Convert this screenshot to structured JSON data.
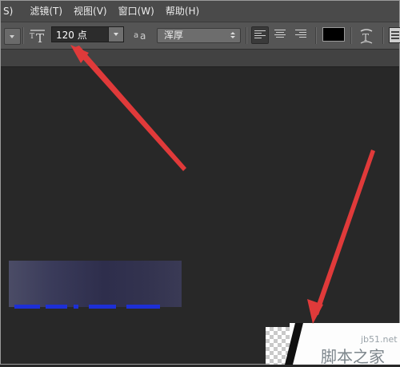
{
  "menubar": {
    "items": [
      "S)",
      "滤镜(T)",
      "视图(V)",
      "窗口(W)",
      "帮助(H)"
    ]
  },
  "options_bar": {
    "font_size_value": "120 点",
    "antialias_method": "浑厚",
    "text_color": "#000000",
    "icons": [
      "tool-preset-dropdown",
      "text-orientation-icon",
      "antialias-icon",
      "align-left-icon",
      "align-center-icon",
      "align-right-icon",
      "warp-text-icon",
      "character-panel-icon"
    ]
  },
  "annotations": {
    "arrow_color": "#e03a3a"
  },
  "watermark": {
    "url": "jb51.net",
    "name": "脚本之家"
  },
  "colors": {
    "menubar_bg": "#4a4a4a",
    "options_bg": "#555555",
    "canvas_bg": "#282828",
    "text_layer_blue": "#1d2fd6"
  }
}
